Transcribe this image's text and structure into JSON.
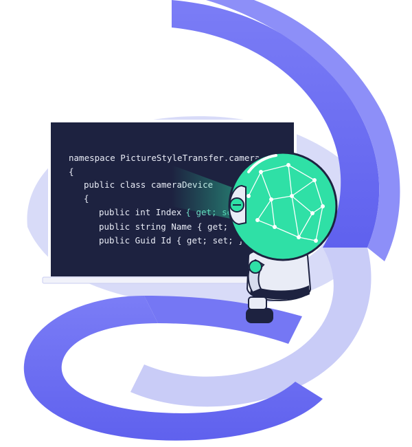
{
  "code": {
    "lines": [
      "namespace PictureStyleTransfer.camera",
      "{",
      "public class cameraDevice",
      "{",
      "public int Index",
      "public string Name { get; set; }",
      "public Guid Id { get; set; }"
    ],
    "highlight": "{ get; set; }"
  },
  "colors": {
    "screen": "#1d2240",
    "ribbon_dark": "#6a6cf2",
    "ribbon_light": "#d6d9f8",
    "robot_head": "#2fe0a6",
    "robot_body": "#e9ecf6",
    "beam": "#2fe0a6"
  },
  "icons": {
    "robot": "robot-icon",
    "network": "neural-network-icon"
  }
}
